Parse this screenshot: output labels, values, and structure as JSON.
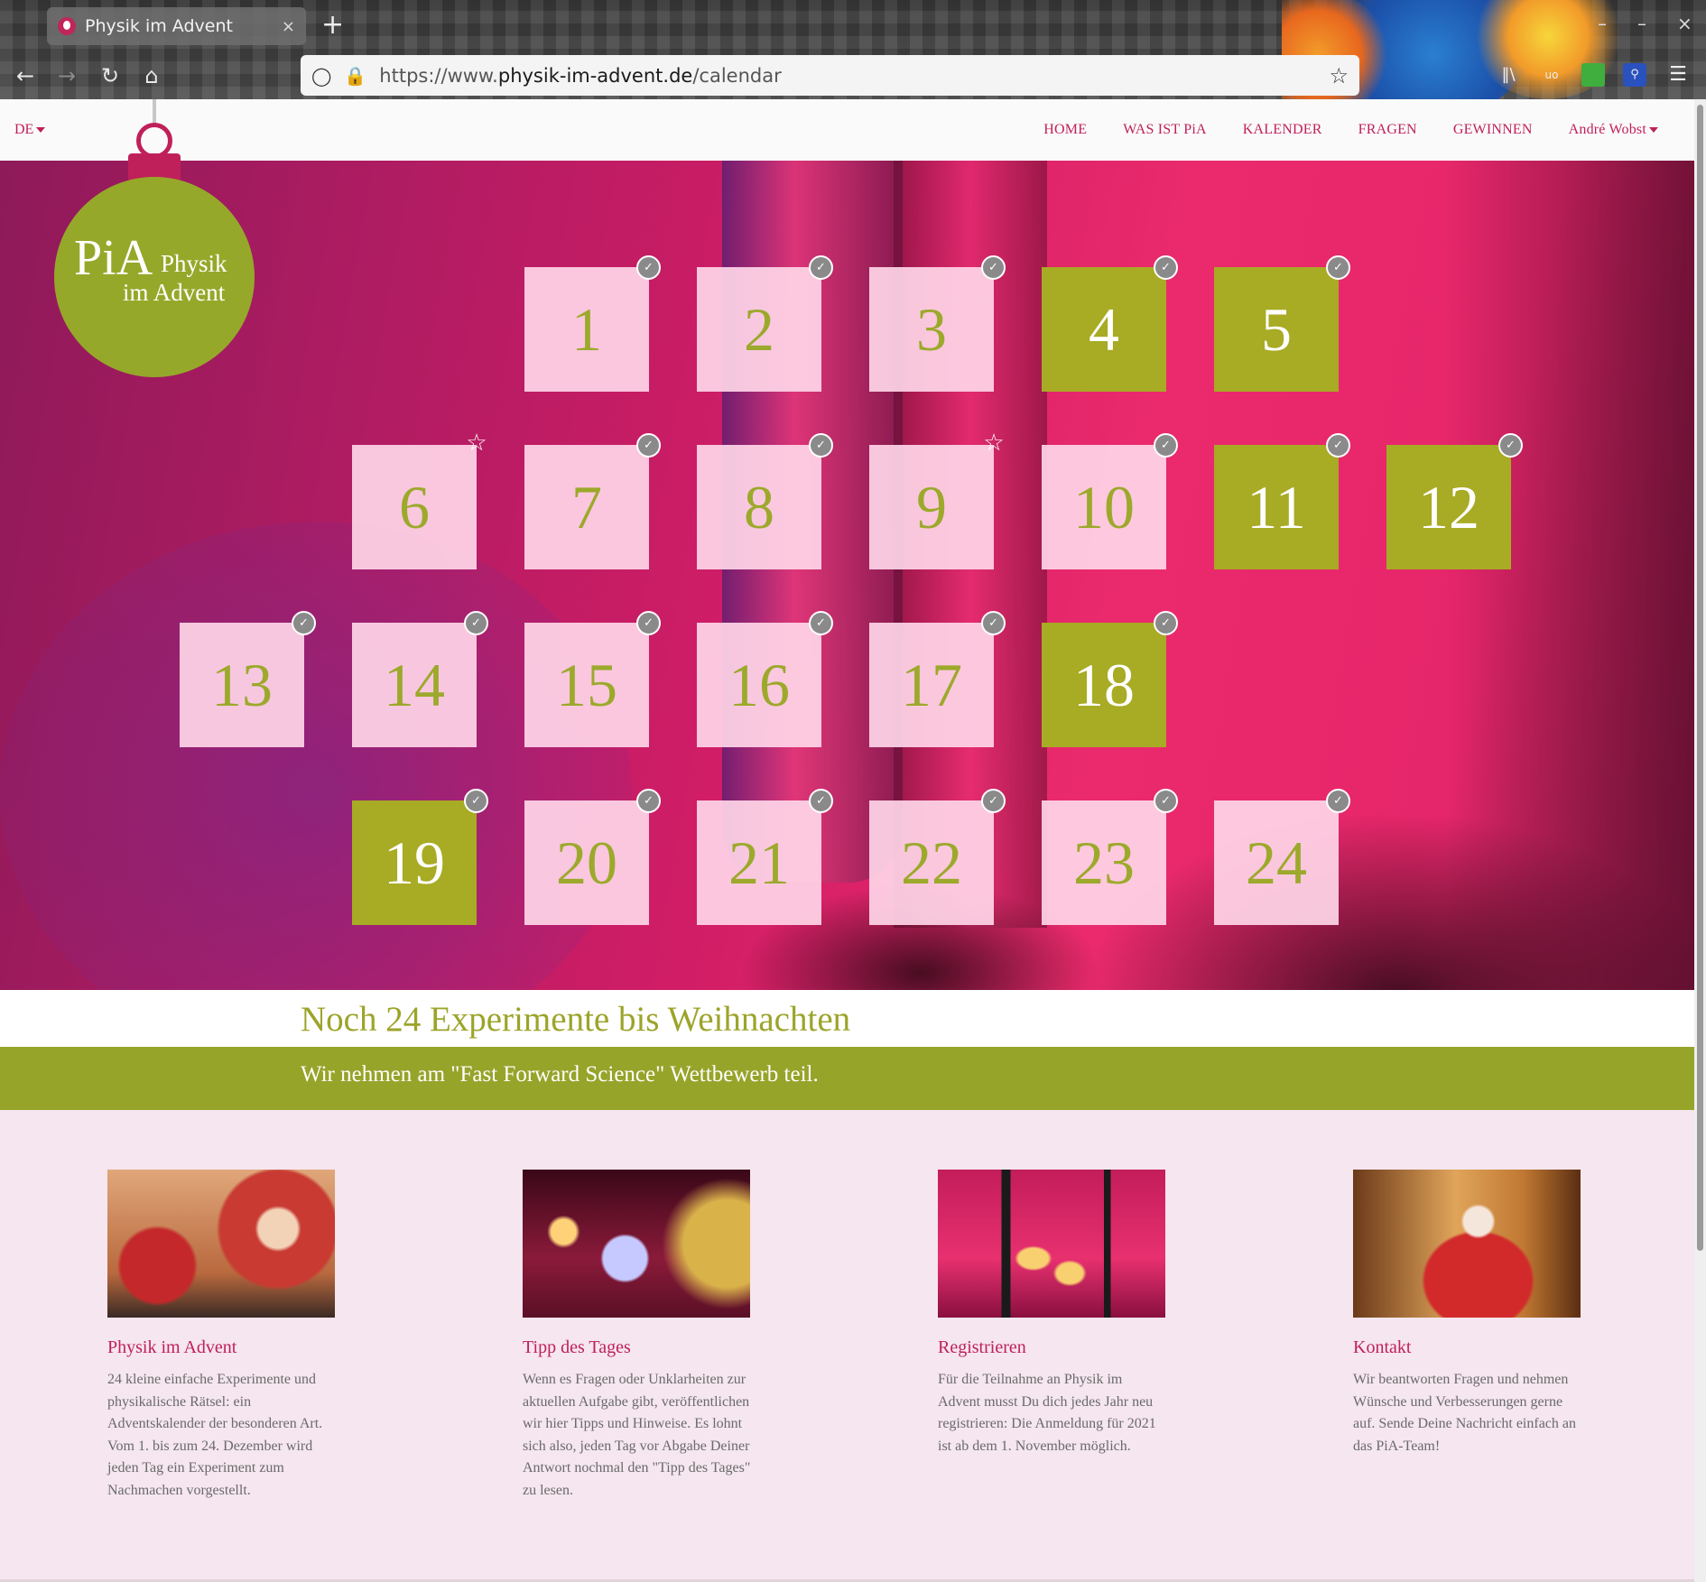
{
  "browser": {
    "tab_title": "Physik im Advent",
    "tab_close": "×",
    "new_tab": "+",
    "url_prefix": "https://www.",
    "url_domain": "physik-im-advent.de",
    "url_path": "/calendar",
    "window_controls": [
      "–",
      "–",
      "×"
    ],
    "nav_icons": [
      "back-icon",
      "forward-icon",
      "reload-icon",
      "home-icon"
    ],
    "toolbar_icons": [
      "library-icon",
      "ublock-icon",
      "extension-icon",
      "password-icon",
      "menu-icon"
    ]
  },
  "nav": {
    "lang": "DE",
    "items": [
      "HOME",
      "WAS IST PiA",
      "KALENDER",
      "FRAGEN",
      "GEWINNEN",
      "André Wobst"
    ]
  },
  "logo": {
    "pia": "PiA",
    "line1": "Physik",
    "line2": "im Advent"
  },
  "calendar": {
    "doors": [
      {
        "day": "1",
        "state": "closed",
        "badge": "check"
      },
      {
        "day": "2",
        "state": "closed",
        "badge": "check"
      },
      {
        "day": "3",
        "state": "closed",
        "badge": "check"
      },
      {
        "day": "4",
        "state": "open",
        "badge": "check"
      },
      {
        "day": "5",
        "state": "open",
        "badge": "check"
      },
      {
        "day": "6",
        "state": "closed",
        "badge": "star"
      },
      {
        "day": "7",
        "state": "closed",
        "badge": "check"
      },
      {
        "day": "8",
        "state": "closed",
        "badge": "check"
      },
      {
        "day": "9",
        "state": "closed",
        "badge": "star"
      },
      {
        "day": "10",
        "state": "closed",
        "badge": "check"
      },
      {
        "day": "11",
        "state": "open",
        "badge": "check"
      },
      {
        "day": "12",
        "state": "open",
        "badge": "check"
      },
      {
        "day": "13",
        "state": "closed",
        "badge": "check"
      },
      {
        "day": "14",
        "state": "closed",
        "badge": "check"
      },
      {
        "day": "15",
        "state": "closed",
        "badge": "check"
      },
      {
        "day": "16",
        "state": "closed",
        "badge": "check"
      },
      {
        "day": "17",
        "state": "closed",
        "badge": "check"
      },
      {
        "day": "18",
        "state": "open",
        "badge": "check"
      },
      {
        "day": "19",
        "state": "open",
        "badge": "check"
      },
      {
        "day": "20",
        "state": "closed",
        "badge": "check"
      },
      {
        "day": "21",
        "state": "closed",
        "badge": "check"
      },
      {
        "day": "22",
        "state": "closed",
        "badge": "check"
      },
      {
        "day": "23",
        "state": "closed",
        "badge": "check"
      },
      {
        "day": "24",
        "state": "closed",
        "badge": "check"
      }
    ]
  },
  "countdown": "Noch 24 Experimente bis Weihnachten",
  "contest": "Wir nehmen am \"Fast Forward Science\" Wettbewerb teil.",
  "cards": [
    {
      "title": "Physik im Advent",
      "text": "24 kleine einfache Experimente und physikalische Rätsel: ein Adventskalender der besonderen Art. Vom 1. bis zum 24. Dezember wird jeden Tag ein Experiment zum Nachmachen vorgestellt."
    },
    {
      "title": "Tipp des Tages",
      "text": "Wenn es Fragen oder Unklarheiten zur aktuellen Aufgabe gibt, veröffentlichen wir hier Tipps und Hinweise. Es lohnt sich also, jeden Tag vor Abgabe Deiner Antwort nochmal den \"Tipp des Tages\" zu lesen."
    },
    {
      "title": "Registrieren",
      "text": "Für die Teilnahme an Physik im Advent musst Du dich jedes Jahr neu registrieren: Die Anmeldung für 2021 ist ab dem 1. November möglich."
    },
    {
      "title": "Kontakt",
      "text": "Wir beantworten Fragen und nehmen Wünsche und Verbesserungen gerne auf. Sende Deine Nachricht einfach an das PiA-Team!"
    }
  ],
  "colors": {
    "accent": "#c0205a",
    "green": "#96a42a",
    "door_open": "#a8ab24",
    "door_closed": "#ffd6e8"
  }
}
